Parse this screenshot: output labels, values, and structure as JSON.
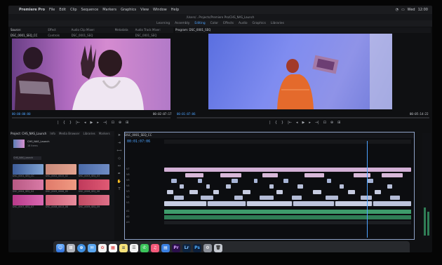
{
  "menubar": {
    "items": [
      "Premiere Pro",
      "File",
      "Edit",
      "Clip",
      "Sequence",
      "Markers",
      "Graphics",
      "View",
      "Window",
      "Help"
    ],
    "status": [
      "Wed",
      "12:00"
    ]
  },
  "window_title": "/Users/...Projects/Premiere Pro/CHS_NAS_Launch",
  "workspaces": [
    "Learning",
    "Assembly",
    "Editing",
    "Color",
    "Effects",
    "Audio",
    "Graphics",
    "Libraries"
  ],
  "active_workspace": "Editing",
  "source_monitor": {
    "tabs": [
      "Source: DSC_0001_SEQ_CC",
      "Effect Controls",
      "Audio Clip Mixer: DSC_0001_SEQ",
      "Metadata",
      "Audio Track Mixer: DSC_0001_SEQ"
    ],
    "timecode_in": "00:00:00:00",
    "timecode_out": "00:02:07:17"
  },
  "program_monitor": {
    "tabs": [
      "Program: DSC_0001_SEQ"
    ],
    "timecode_in": "00:01:07:06",
    "timecode_out": "00:05:14:22"
  },
  "transport_glyphs": [
    "|",
    "{",
    "}",
    "|←",
    "◂",
    "▶",
    "▸",
    "→|",
    "⊡",
    "⊕",
    "⊞"
  ],
  "project": {
    "tabs": [
      "Project: CHS_NAS_Launch",
      "Info",
      "Media Browser",
      "Libraries",
      "Markers"
    ],
    "bin_name": "CHS_NAS_Launch",
    "item_count": "16 Items",
    "thumbs": [
      {
        "label": "DSC_0001_SEQ_CC",
        "color": "#5c7fb6"
      },
      {
        "label": "DSC_0002_0015_02",
        "color": "#c07a6e"
      },
      {
        "label": "DSC_0003_SEQ_03",
        "color": "#5e7fb0"
      },
      {
        "label": "DSC_0004_SEQ_04",
        "color": "#b8587e"
      },
      {
        "label": "DSC_0005_0006_05",
        "color": "#d97b6c"
      },
      {
        "label": "DSC_0006_SEQ_06",
        "color": "#c94f6c"
      },
      {
        "label": "DSC_0007_SEQ_07",
        "color": "#c44a8c"
      },
      {
        "label": "DSC_0008_0013_08",
        "color": "#d95a7a"
      },
      {
        "label": "DSC_0009_SEQ_09",
        "color": "#c75572"
      }
    ]
  },
  "timeline": {
    "sequence_tab": "DSC_0001_SEQ_CC",
    "timecode": "00:01:07:06",
    "tracks": [
      "V7",
      "V6",
      "V5",
      "V4",
      "V3",
      "V2",
      "V1",
      "A1",
      "A2",
      "A3"
    ]
  },
  "dock_apps": [
    "Finder",
    "Launchpad",
    "Safari",
    "Mail",
    "Photos",
    "Calendar",
    "Notes",
    "Reminders",
    "Messages",
    "Music",
    "Keynote",
    "Pr",
    "Lr",
    "Ps",
    "Settings",
    "Trash"
  ],
  "colors": {
    "accent": "#4da3ff",
    "clip_pink": "#d8b8d8",
    "clip_blue": "#a7b4d6",
    "audio_green": "#3e9c6b"
  }
}
